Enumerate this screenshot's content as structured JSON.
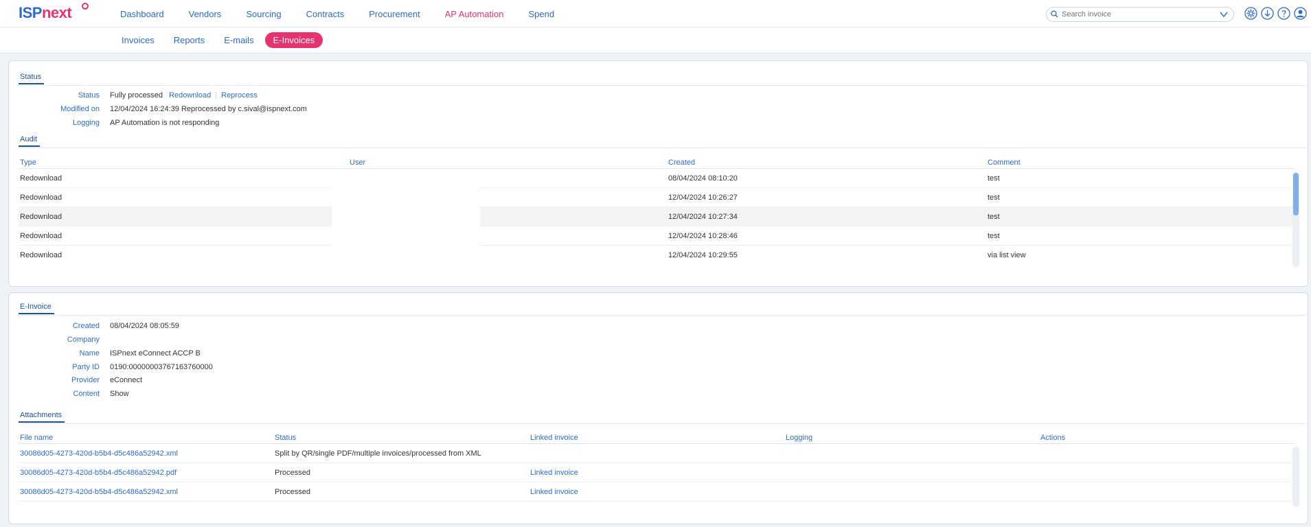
{
  "logo": {
    "part1": "ISP",
    "part2": "next"
  },
  "topnav": [
    "Dashboard",
    "Vendors",
    "Sourcing",
    "Contracts",
    "Procurement",
    "AP Automation",
    "Spend"
  ],
  "search": {
    "placeholder": "Search invoice"
  },
  "subnav": [
    "Invoices",
    "Reports",
    "E-mails",
    "E-Invoices"
  ],
  "status_section": {
    "tab": "Status",
    "rows": [
      {
        "label": "Status",
        "value": "Fully processed",
        "actions": [
          "Redownload",
          "Reprocess"
        ]
      },
      {
        "label": "Modified on",
        "value": "12/04/2024 16:24:39 Reprocessed by c.sival@ispnext.com"
      },
      {
        "label": "Logging",
        "value": "AP Automation is not responding"
      }
    ]
  },
  "audit": {
    "tab": "Audit",
    "columns": [
      "Type",
      "User",
      "Created",
      "Comment"
    ],
    "rows": [
      [
        "Redownload",
        "",
        "08/04/2024 08:10:20",
        "test"
      ],
      [
        "Redownload",
        "",
        "12/04/2024 10:26:27",
        "test"
      ],
      [
        "Redownload",
        "",
        "12/04/2024 10:27:34",
        "test"
      ],
      [
        "Redownload",
        "",
        "12/04/2024 10:28:46",
        "test"
      ],
      [
        "Redownload",
        "",
        "12/04/2024 10:29:55",
        "via list view"
      ]
    ]
  },
  "einvoice": {
    "tab": "E-Invoice",
    "rows": [
      {
        "label": "Created",
        "value": "08/04/2024 08:05:59"
      },
      {
        "label": "Company",
        "value": ""
      },
      {
        "label": "Name",
        "value": "ISPnext eConnect ACCP B"
      },
      {
        "label": "Party ID",
        "value": "0190:00000003767163760000"
      },
      {
        "label": "Provider",
        "value": "eConnect"
      },
      {
        "label": "Content",
        "value": "Show"
      }
    ]
  },
  "attachments": {
    "tab": "Attachments",
    "columns": [
      "File name",
      "Status",
      "Linked invoice",
      "Logging",
      "Actions"
    ],
    "rows": [
      [
        "30086d05-4273-420d-b5b4-d5c486a52942.xml",
        "Split by QR/single PDF/multiple invoices/processed from XML",
        "",
        "",
        ""
      ],
      [
        "30086d05-4273-420d-b5b4-d5c486a52942.pdf",
        "Processed",
        "Linked invoice",
        "",
        ""
      ],
      [
        "30086d05-4273-420d-b5b4-d5c486a52942.xml",
        "Processed",
        "Linked invoice",
        "",
        ""
      ]
    ]
  },
  "colors": {
    "brand_blue": "#2c6bc9",
    "brand_pink": "#e6326e",
    "tab_dark_blue": "#1f4f9c"
  },
  "icons": [
    "search-icon",
    "chevron-down-icon",
    "settings-icon",
    "download-icon",
    "help-icon",
    "user-icon"
  ]
}
